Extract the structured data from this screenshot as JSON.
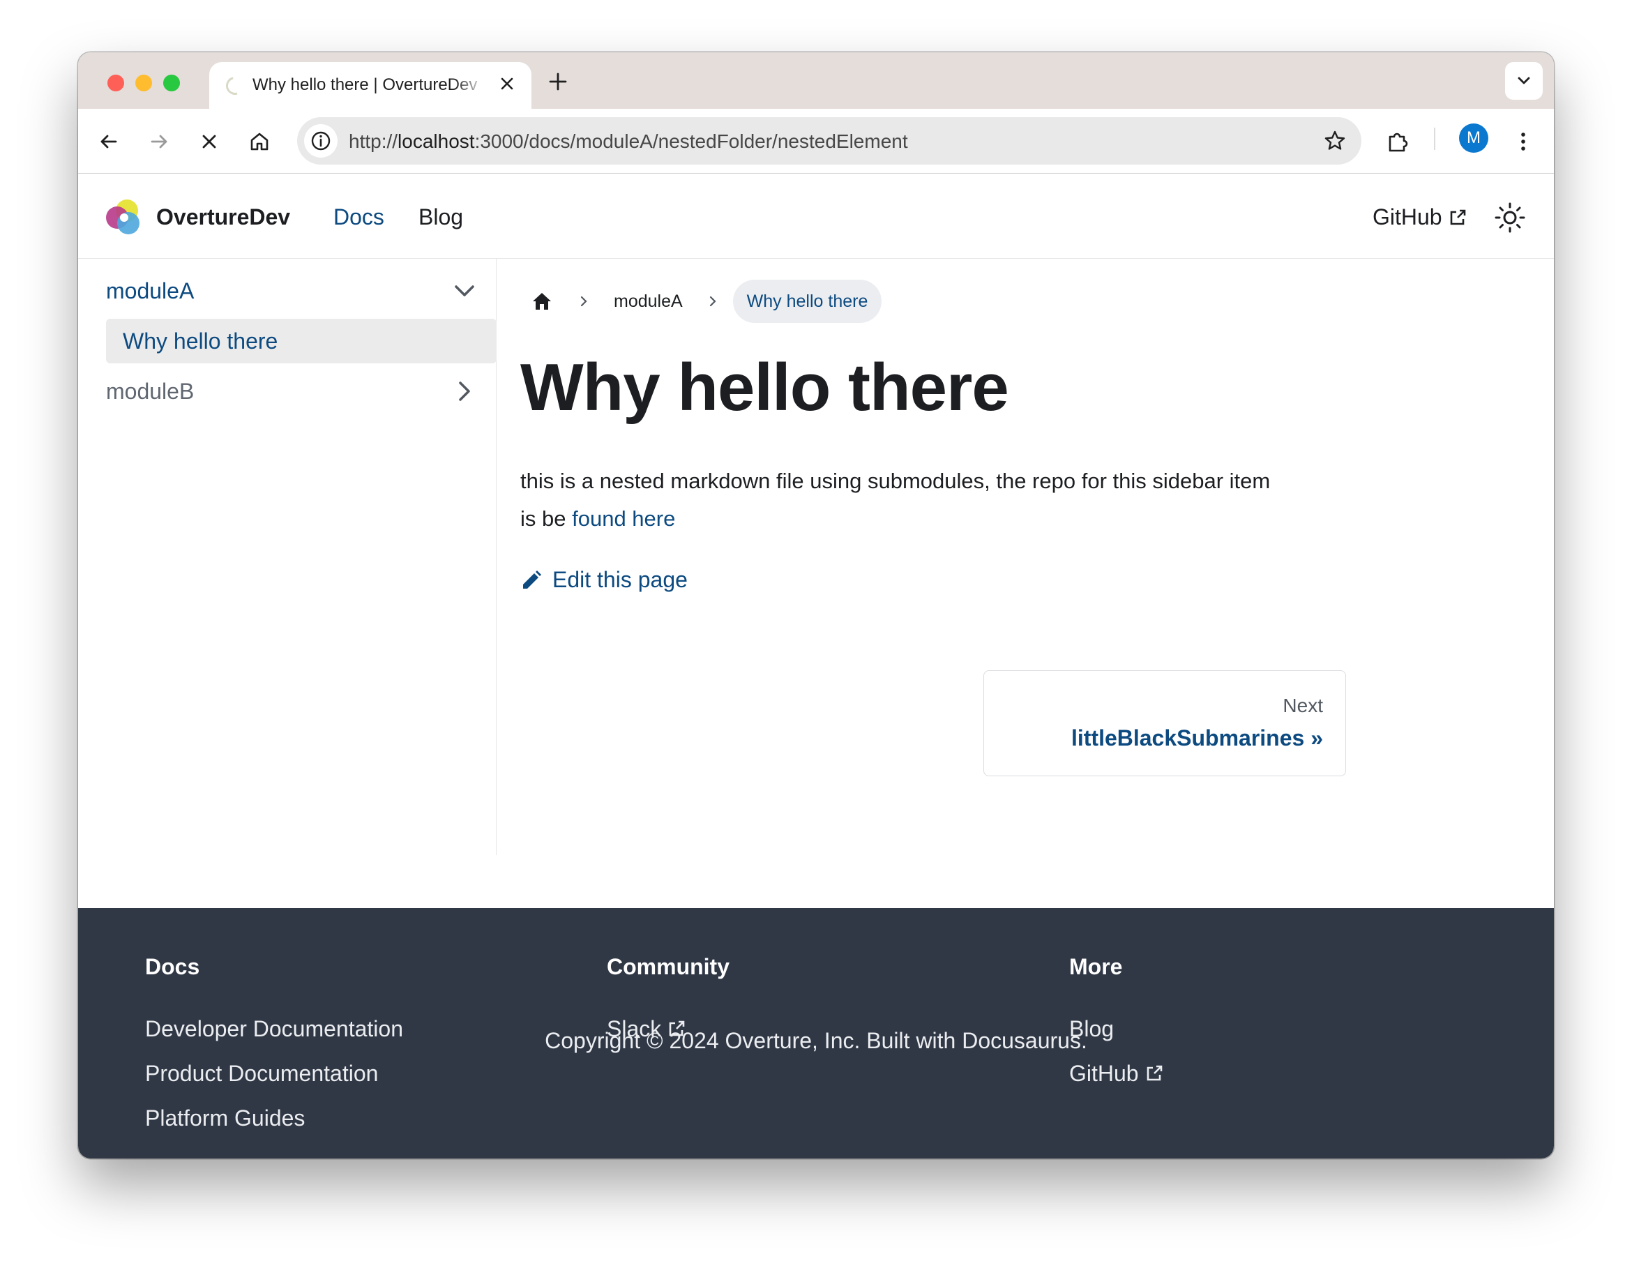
{
  "browser": {
    "tab_title": "Why hello there | OvertureDev",
    "url_scheme": "http://",
    "url_host": "localhost",
    "url_rest": ":3000/docs/moduleA/nestedFolder/nestedElement",
    "profile_initial": "M"
  },
  "navbar": {
    "brand": "OvertureDev",
    "items": [
      "Docs",
      "Blog"
    ],
    "github": "GitHub"
  },
  "sidebar": {
    "moduleA": "moduleA",
    "active_item": "Why hello there",
    "moduleB": "moduleB"
  },
  "breadcrumb": {
    "items": [
      "moduleA",
      "Why hello there"
    ]
  },
  "article": {
    "title": "Why hello there",
    "paragraph": "this is a nested markdown file using submodules, the repo for this sidebar item is be ",
    "link": "found here",
    "edit": "Edit this page"
  },
  "pagination": {
    "label": "Next",
    "title": "littleBlackSubmarines »"
  },
  "footer": {
    "columns": [
      {
        "title": "Docs",
        "links": [
          "Developer Documentation",
          "Product Documentation",
          "Platform Guides"
        ]
      },
      {
        "title": "Community",
        "links": [
          "Slack"
        ]
      },
      {
        "title": "More",
        "links": [
          "Blog",
          "GitHub"
        ]
      }
    ],
    "copyright": "Copyright © 2024 Overture, Inc. Built with Docusaurus."
  },
  "colors": {
    "primary": "#0c4a80",
    "footer_bg": "#303846"
  }
}
